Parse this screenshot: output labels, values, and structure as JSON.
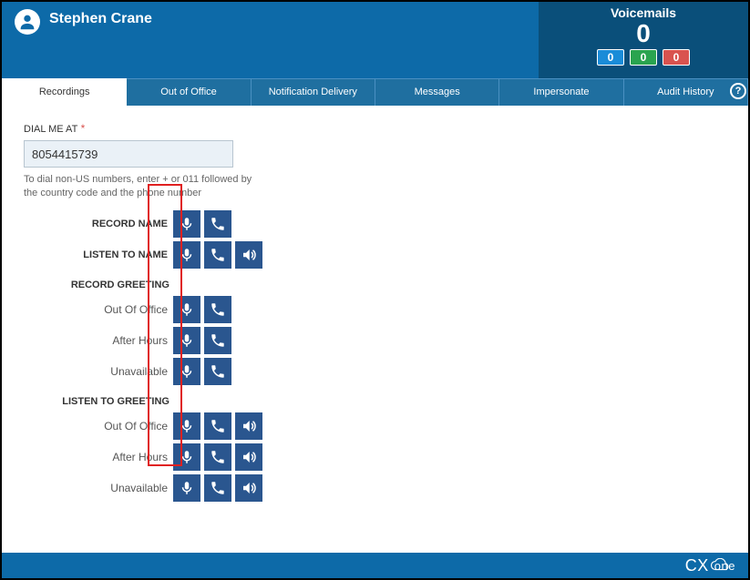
{
  "header": {
    "username": "Stephen Crane",
    "voicemails_label": "Voicemails",
    "voicemails_count": "0",
    "badges": {
      "blue": "0",
      "green": "0",
      "red": "0"
    }
  },
  "tabs": {
    "recordings": "Recordings",
    "out_of_office": "Out of Office",
    "notification_delivery": "Notification Delivery",
    "messages": "Messages",
    "impersonate": "Impersonate",
    "audit_history": "Audit History"
  },
  "help_symbol": "?",
  "dial": {
    "label": "DIAL ME AT",
    "required": "*",
    "value": "8054415739",
    "hint": "To dial non-US numbers, enter + or 011 followed by the country code and the phone number"
  },
  "rows": {
    "record_name": "RECORD NAME",
    "listen_to_name": "LISTEN TO NAME",
    "record_greeting": "RECORD GREETING",
    "listen_to_greeting": "LISTEN TO GREETING",
    "out_of_office": "Out Of Office",
    "after_hours": "After Hours",
    "unavailable": "Unavailable"
  },
  "icons": {
    "mic": "mic-icon",
    "phone": "phone-icon",
    "speaker": "speaker-icon"
  },
  "footer": {
    "logo_cx": "CX",
    "logo_one": "one"
  }
}
